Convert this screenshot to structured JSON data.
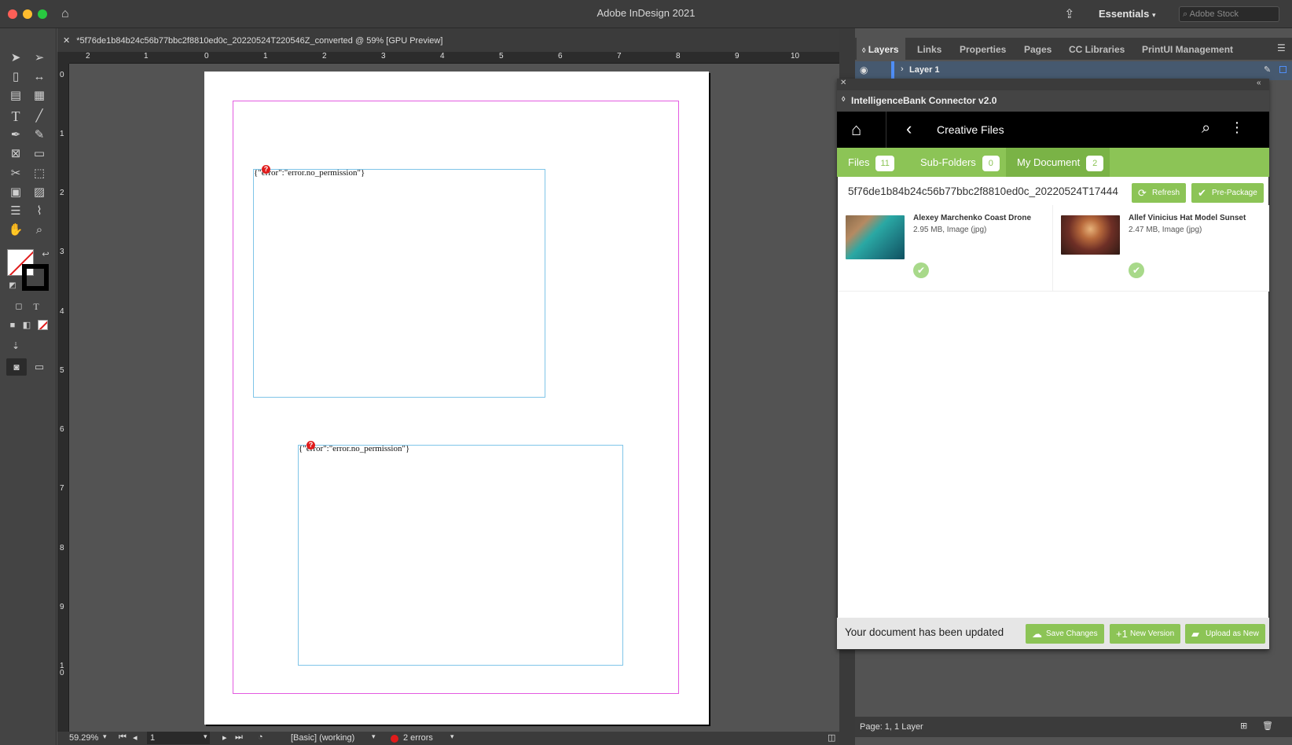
{
  "app": {
    "title": "Adobe InDesign 2021",
    "workspace": "Essentials",
    "stock_search_placeholder": "Adobe Stock"
  },
  "document": {
    "tab_title": "*5f76de1b84b24c56b77bbc2f8810ed0c_20220524T220546Z_converted @ 59% [GPU Preview]",
    "ruler_h_labels": [
      "2",
      "1",
      "0",
      "1",
      "2",
      "3",
      "4",
      "5",
      "6",
      "7",
      "8",
      "9",
      "10"
    ],
    "ruler_v_labels": [
      "0",
      "1",
      "2",
      "3",
      "4",
      "5",
      "6",
      "7",
      "8",
      "9",
      "1\n0"
    ],
    "frames": [
      {
        "text": "{\"error\":\"error.no_permission\"}",
        "error_marker": "?"
      },
      {
        "text": "{\"error\":\"error.no_permission\"}",
        "error_marker": "?"
      }
    ]
  },
  "status": {
    "zoom": "59.29%",
    "page": "1",
    "profile": "[Basic] (working)",
    "errors": "2 errors"
  },
  "panels": {
    "tabs": [
      "Layers",
      "Links",
      "Properties",
      "Pages",
      "CC Libraries",
      "PrintUI Management"
    ],
    "layer_name": "Layer 1",
    "footer": "Page: 1, 1 Layer"
  },
  "connector": {
    "title": "IntelligenceBank Connector v2.0",
    "nav_title": "Creative Files",
    "tabs": [
      {
        "label": "Files",
        "count": "11"
      },
      {
        "label": "Sub-Folders",
        "count": "0"
      },
      {
        "label": "My Document",
        "count": "2"
      }
    ],
    "document_name": "5f76de1b84b24c56b77bbc2f8810ed0c_20220524T17444",
    "refresh_label": "Refresh",
    "prepackage_label": "Pre-Package",
    "files": [
      {
        "name": "Alexey Marchenko Coast Drone",
        "meta": "2.95 MB, Image (jpg)"
      },
      {
        "name": "Allef Vinicius Hat Model Sunset",
        "meta": "2.47 MB, Image (jpg)"
      }
    ],
    "footer_message": "Your document has been updated",
    "save_changes_label": "Save Changes",
    "new_version_label": "New Version",
    "upload_new_label": "Upload as New",
    "accent_color": "#8cc456"
  }
}
